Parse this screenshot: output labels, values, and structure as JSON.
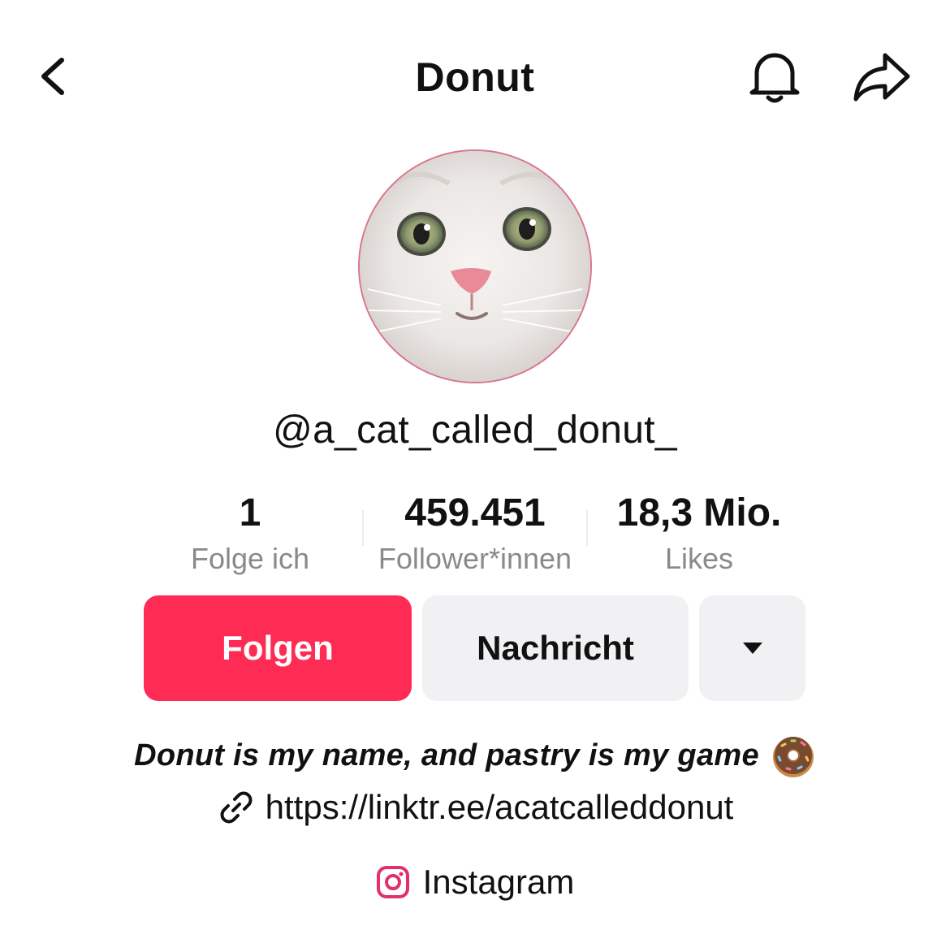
{
  "header": {
    "title": "Donut",
    "icons": {
      "back": "chevron-left-icon",
      "notifications": "bell-icon",
      "share": "share-arrow-icon"
    }
  },
  "profile": {
    "handle": "@a_cat_called_donut_",
    "avatar_ring_color": "#d9748f"
  },
  "stats": [
    {
      "value": "1",
      "label": "Folge ich"
    },
    {
      "value": "459.451",
      "label": "Follower*innen"
    },
    {
      "value": "18,3 Mio.",
      "label": "Likes"
    }
  ],
  "actions": {
    "follow_label": "Folgen",
    "message_label": "Nachricht",
    "more_icon": "caret-down-icon",
    "follow_color": "#fe2c55",
    "secondary_color": "#f1f1f3"
  },
  "bio": {
    "text": "Donut is my name, and pastry is my game",
    "emoji_icon": "donut-icon",
    "link": "https://linktr.ee/acatcalleddonut",
    "link_icon": "link-icon",
    "social_label": "Instagram",
    "social_icon": "instagram-icon",
    "social_color": "#e1306c"
  }
}
